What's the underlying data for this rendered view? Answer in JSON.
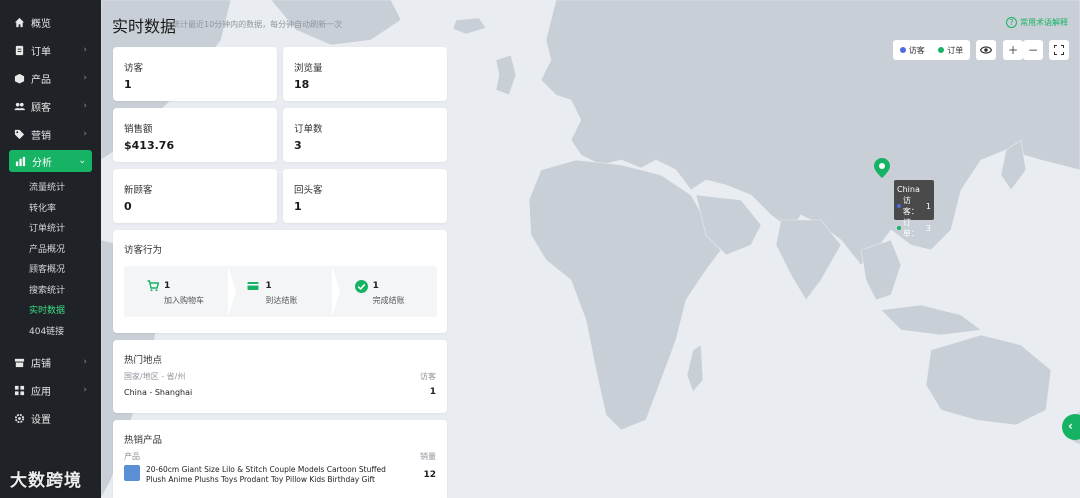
{
  "sidebar": {
    "items": [
      {
        "label": "概览",
        "icon": "home-icon",
        "has_chevron": false
      },
      {
        "label": "订单",
        "icon": "order-icon",
        "has_chevron": true
      },
      {
        "label": "产品",
        "icon": "product-icon",
        "has_chevron": true
      },
      {
        "label": "顾客",
        "icon": "customers-icon",
        "has_chevron": true
      },
      {
        "label": "营销",
        "icon": "tag-icon",
        "has_chevron": true
      }
    ],
    "active": {
      "label": "分析",
      "icon": "bar-chart-icon"
    },
    "sub_items": [
      {
        "label": "流量统计",
        "active": false
      },
      {
        "label": "转化率",
        "active": false
      },
      {
        "label": "订单统计",
        "active": false
      },
      {
        "label": "产品概况",
        "active": false
      },
      {
        "label": "顾客概况",
        "active": false
      },
      {
        "label": "搜索统计",
        "active": false
      },
      {
        "label": "实时数据",
        "active": true
      },
      {
        "label": "404链接",
        "active": false
      }
    ],
    "bottom_items": [
      {
        "label": "店铺",
        "icon": "store-icon",
        "has_chevron": true
      },
      {
        "label": "应用",
        "icon": "apps-icon",
        "has_chevron": true
      },
      {
        "label": "设置",
        "icon": "gear-icon",
        "has_chevron": false
      }
    ]
  },
  "header": {
    "title": "实时数据",
    "subtitle": "统计最近10分钟内的数据，每分钟自动刷新一次",
    "help_link": "常用术语解释"
  },
  "stats": [
    {
      "label": "访客",
      "value": "1"
    },
    {
      "label": "浏览量",
      "value": "18"
    },
    {
      "label": "销售额",
      "value": "$413.76"
    },
    {
      "label": "订单数",
      "value": "3"
    },
    {
      "label": "新顾客",
      "value": "0"
    },
    {
      "label": "回头客",
      "value": "1"
    }
  ],
  "behavior": {
    "title": "访客行为",
    "steps": [
      {
        "count": "1",
        "label": "加入购物车",
        "icon": "cart-icon"
      },
      {
        "count": "1",
        "label": "到达结账",
        "icon": "card-icon"
      },
      {
        "count": "1",
        "label": "完成结账",
        "icon": "check-circle-icon"
      }
    ]
  },
  "locations": {
    "title": "热门地点",
    "col_region": "国家/地区 - 省/州",
    "col_visitors": "访客",
    "rows": [
      {
        "region": "China - Shanghai",
        "visitors": "1"
      }
    ]
  },
  "products": {
    "title": "热销产品",
    "col_product": "产品",
    "col_sales": "销量",
    "rows": [
      {
        "name_line1": "20-60cm Giant Size Lilo & Stitch Couple Models Cartoon Stuffed",
        "name_line2": "Plush Anime Plushs Toys Prodant Toy Pillow Kids Birthday Gift",
        "sales": "12"
      }
    ]
  },
  "map": {
    "legend_visitors": "访客",
    "legend_orders": "订单",
    "visitor_color": "#4f6bdc",
    "order_color": "#16b364",
    "tooltip": {
      "country": "China",
      "visitors_label": "访客：",
      "visitors": "1",
      "orders_label": "订单：",
      "orders": "3"
    }
  },
  "watermark": "大数跨境"
}
